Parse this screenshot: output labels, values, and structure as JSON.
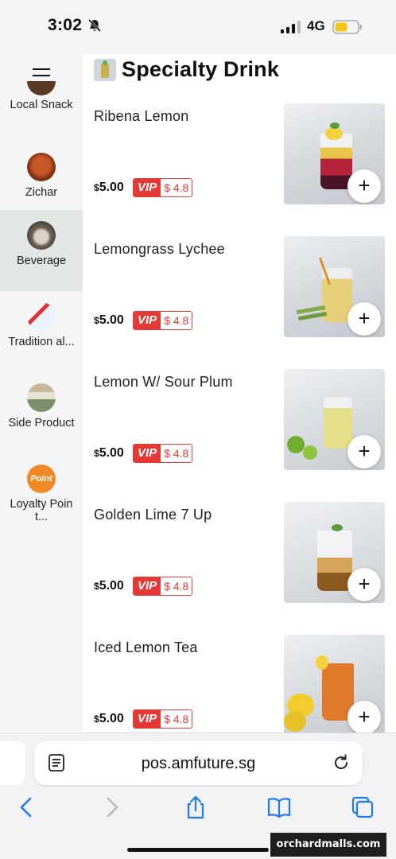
{
  "status_bar": {
    "time": "3:02",
    "network": "4G"
  },
  "sidebar": {
    "menu_icon": "hamburger-icon",
    "categories": [
      {
        "label": "Local Snack",
        "active": false
      },
      {
        "label": "Zichar",
        "active": false
      },
      {
        "label": "Beverage",
        "active": true
      },
      {
        "label": "Tradition al...",
        "active": false
      },
      {
        "label": "Side Product",
        "active": false
      },
      {
        "label": "Loyalty Point...",
        "active": false,
        "thumb_text": "Point"
      }
    ]
  },
  "section": {
    "title": "Specialty Drink"
  },
  "items": [
    {
      "name": "Ribena Lemon",
      "currency": "$",
      "price": "5.00",
      "vip_tag": "VIP",
      "vip_price": "$ 4.8"
    },
    {
      "name": "Lemongrass Lychee",
      "currency": "$",
      "price": "5.00",
      "vip_tag": "VIP",
      "vip_price": "$ 4.8"
    },
    {
      "name": "Lemon W/ Sour Plum",
      "currency": "$",
      "price": "5.00",
      "vip_tag": "VIP",
      "vip_price": "$ 4.8"
    },
    {
      "name": "Golden Lime 7 Up",
      "currency": "$",
      "price": "5.00",
      "vip_tag": "VIP",
      "vip_price": "$ 4.8"
    },
    {
      "name": "Iced Lemon Tea",
      "currency": "$",
      "price": "5.00",
      "vip_tag": "VIP",
      "vip_price": "$ 4.8"
    }
  ],
  "add_button_label": "+",
  "browser": {
    "url": "pos.amfuture.sg"
  },
  "watermark": "orchardmalls.com",
  "colors": {
    "accent_red": "#e53935",
    "sidebar_bg": "#f4f5f7",
    "active_bg": "#e2e7e3"
  }
}
